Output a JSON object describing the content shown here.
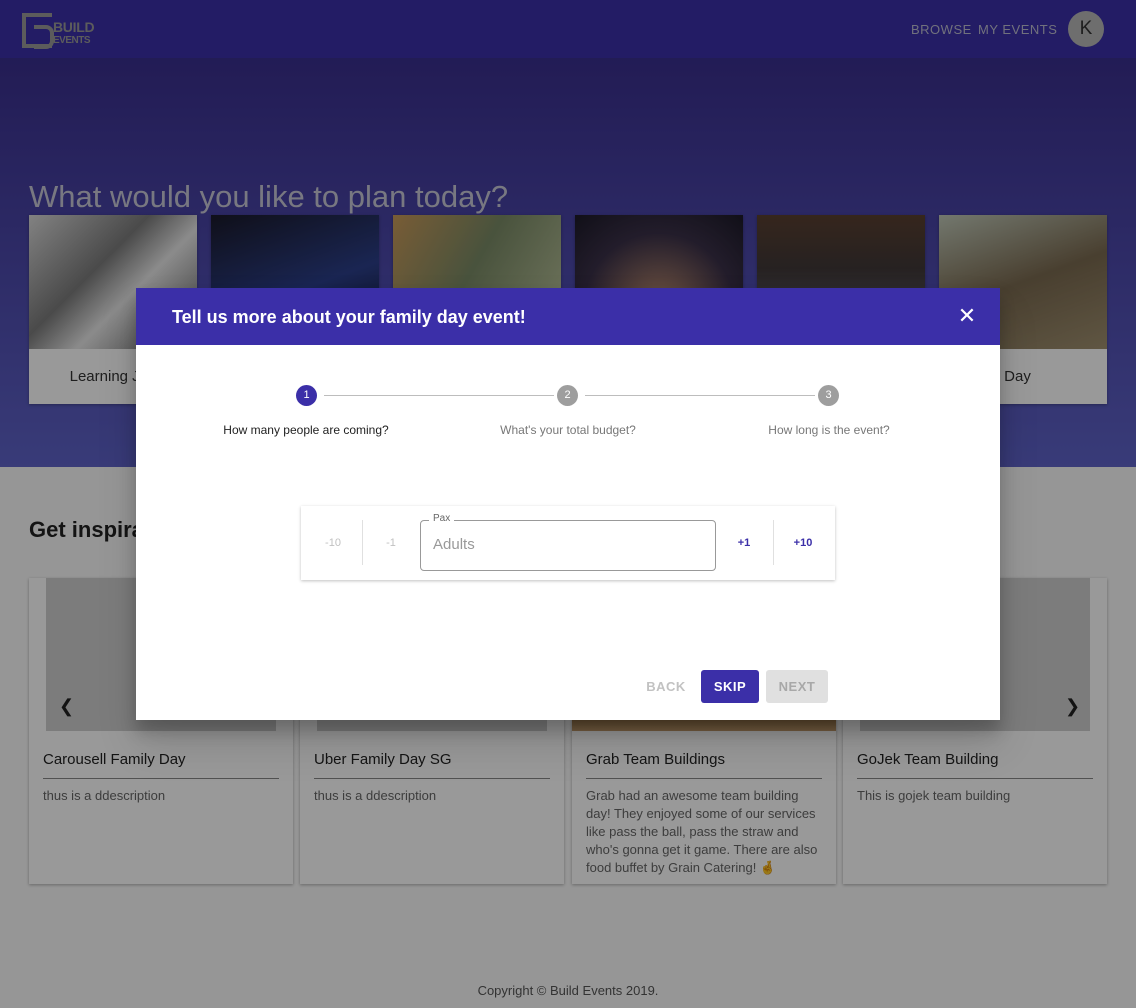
{
  "header": {
    "logo_top": "BUILD",
    "logo_bottom": "EVENTS",
    "nav": [
      "BROWSE",
      "MY EVENTS"
    ],
    "avatar_initial": "K"
  },
  "hero": {
    "title": "What would you like to plan today?",
    "categories": [
      {
        "label": "Learning Jou"
      },
      {
        "label": ""
      },
      {
        "label": ""
      },
      {
        "label": ""
      },
      {
        "label": ""
      },
      {
        "label": "amily Day"
      }
    ]
  },
  "inspiration": {
    "title": "Get inspira",
    "cards": [
      {
        "title": "Carousell Family Day",
        "description": "thus is a ddescription"
      },
      {
        "title": "Uber Family Day SG",
        "description": "thus is a ddescription"
      },
      {
        "title": "Grab Team Buildings",
        "description": "Grab had an awesome team building day! They enjoyed some of our services like pass the ball, pass the straw and who's gonna get it game. There are also food buffet by Grain Catering! 🤞"
      },
      {
        "title": "GoJek Team Building",
        "description": "This is gojek team building"
      }
    ]
  },
  "modal": {
    "title": "Tell us more about your family day event!",
    "close_icon": "close-icon",
    "steps": [
      {
        "number": "1",
        "label": "How many people are coming?",
        "active": true
      },
      {
        "number": "2",
        "label": "What's your total budget?",
        "active": false
      },
      {
        "number": "3",
        "label": "How long is the event?",
        "active": false
      }
    ],
    "pax": {
      "legend": "Pax",
      "placeholder": "Adults",
      "value": "",
      "minus_10": "-10",
      "minus_1": "-1",
      "plus_1": "+1",
      "plus_10": "+10"
    },
    "buttons": {
      "back": "BACK",
      "skip": "SKIP",
      "next": "NEXT"
    }
  },
  "footer": {
    "copyright": "Copyright © Build Events 2019."
  },
  "colors": {
    "primary": "#3b2fa8",
    "hero_start": "#3a2f8e",
    "hero_end": "#5f63c9"
  }
}
